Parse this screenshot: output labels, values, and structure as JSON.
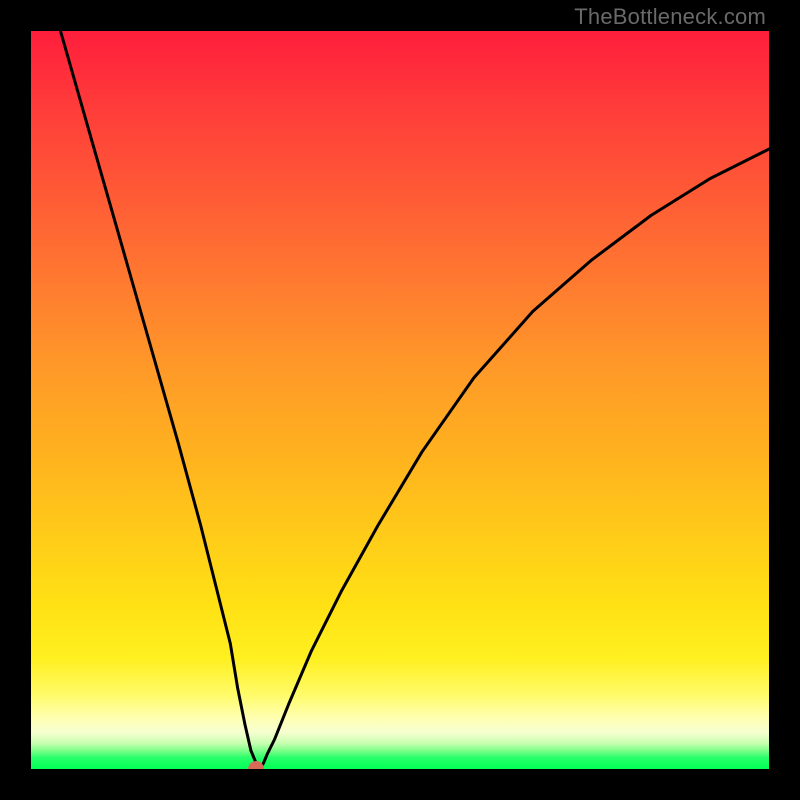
{
  "attribution": "TheBottleneck.com",
  "chart_data": {
    "type": "line",
    "title": "",
    "xlabel": "",
    "ylabel": "",
    "xlim": [
      0,
      100
    ],
    "ylim": [
      0,
      100
    ],
    "grid": false,
    "legend": null,
    "series": [
      {
        "name": "curve",
        "x": [
          4,
          8,
          12,
          16,
          20,
          23,
          25,
          27,
          28,
          29,
          29.8,
          30.5,
          31,
          31.5,
          32,
          33,
          35,
          38,
          42,
          47,
          53,
          60,
          68,
          76,
          84,
          92,
          100
        ],
        "y": [
          100,
          86,
          72,
          58,
          44,
          33,
          25,
          17,
          11,
          6,
          2.5,
          0.8,
          0,
          0.8,
          2,
          4,
          9,
          16,
          24,
          33,
          43,
          53,
          62,
          69,
          75,
          80,
          84
        ]
      }
    ],
    "marker": {
      "x": 30.5,
      "y": 0
    },
    "background_gradient": {
      "stops": [
        {
          "pos": 0.0,
          "color": "#ff1e3c"
        },
        {
          "pos": 0.1,
          "color": "#ff3b3a"
        },
        {
          "pos": 0.22,
          "color": "#ff5a36"
        },
        {
          "pos": 0.34,
          "color": "#ff7a30"
        },
        {
          "pos": 0.46,
          "color": "#ff9a28"
        },
        {
          "pos": 0.58,
          "color": "#ffb31e"
        },
        {
          "pos": 0.7,
          "color": "#ffcf18"
        },
        {
          "pos": 0.78,
          "color": "#ffe114"
        },
        {
          "pos": 0.85,
          "color": "#fff020"
        },
        {
          "pos": 0.9,
          "color": "#fffb6a"
        },
        {
          "pos": 0.93,
          "color": "#ffffb0"
        },
        {
          "pos": 0.95,
          "color": "#f6ffd0"
        },
        {
          "pos": 0.965,
          "color": "#c8ffb0"
        },
        {
          "pos": 0.975,
          "color": "#7dff8a"
        },
        {
          "pos": 0.985,
          "color": "#28ff6a"
        },
        {
          "pos": 1.0,
          "color": "#00ff55"
        }
      ]
    },
    "colors": {
      "curve": "#000000",
      "marker": "#d86a5a",
      "frame": "#000000"
    }
  }
}
